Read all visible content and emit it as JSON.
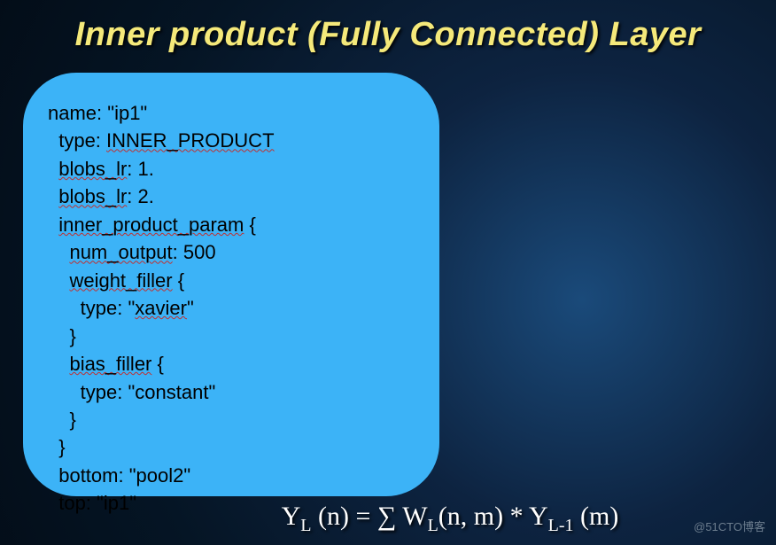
{
  "title": "Inner product  (Fully Connected)  Layer",
  "code": {
    "l1a": "name: \"ip1\"",
    "l2a": "  type: ",
    "l2b": "INNER_PRODUCT",
    "l3a": "  ",
    "l3b": "blobs_lr",
    "l3c": ": 1.",
    "l4a": "  ",
    "l4b": "blobs_lr",
    "l4c": ": 2.",
    "l5a": "  ",
    "l5b": "inner_product_param",
    "l5c": " {",
    "l6a": "    ",
    "l6b": "num_output",
    "l6c": ": 500",
    "l7a": "    ",
    "l7b": "weight_filler",
    "l7c": " {",
    "l8a": "      type: \"",
    "l8b": "xavier",
    "l8c": "\"",
    "l9": "    }",
    "l10a": "    ",
    "l10b": "bias_filler",
    "l10c": " {",
    "l11": "      type: \"constant\"",
    "l12": "    }",
    "l13": "  }",
    "l14": "  bottom: \"pool2\"",
    "l15": "  top: \"ip1\""
  },
  "equation": {
    "y": "Y",
    "sub_l": "L",
    "sub_l1": "L-1",
    "open": " (n) = ∑ W",
    "mid": "(n, m) * Y",
    "end": " (m)"
  },
  "watermark": "@51CTO博客"
}
